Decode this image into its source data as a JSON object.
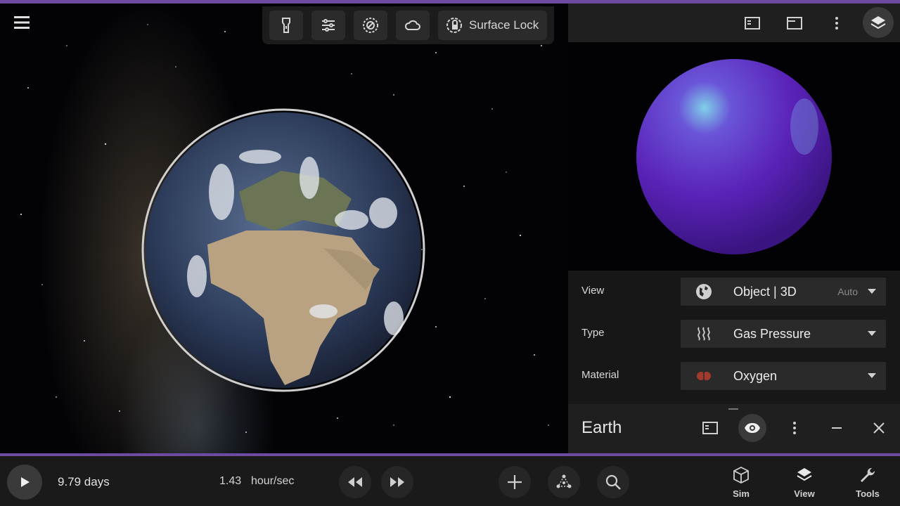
{
  "toolbar": {
    "surface_lock_label": "Surface Lock",
    "icons": [
      "flashlight-icon",
      "sliders-icon",
      "orbit-target-icon",
      "cloud-icon",
      "surface-lock-icon"
    ]
  },
  "panel": {
    "top_icons": [
      "panel-left-icon",
      "panel-window-icon",
      "more-vert-icon",
      "layers-icon"
    ],
    "view": {
      "label": "View",
      "value": "Object | 3D",
      "extra": "Auto",
      "icon": "globe-icon"
    },
    "type": {
      "label": "Type",
      "value": "Gas Pressure",
      "icon": "heat-waves-icon"
    },
    "material": {
      "label": "Material",
      "value": "Oxygen",
      "icon": "oxygen-pill-icon",
      "color": "#a33a2e"
    }
  },
  "object": {
    "name": "Earth",
    "icons": [
      "panel-left-icon",
      "eye-icon",
      "more-vert-icon",
      "minimize-icon",
      "close-icon"
    ]
  },
  "bottom": {
    "elapsed": "9.79 days",
    "rate_value": "1.43",
    "rate_unit": "hour/sec",
    "nav": [
      {
        "label": "Sim",
        "icon": "cube-icon"
      },
      {
        "label": "View",
        "icon": "layers-icon"
      },
      {
        "label": "Tools",
        "icon": "wrench-icon"
      }
    ]
  },
  "colors": {
    "accent": "#6e4aa0",
    "preview_sphere": "#6a2fd0"
  }
}
